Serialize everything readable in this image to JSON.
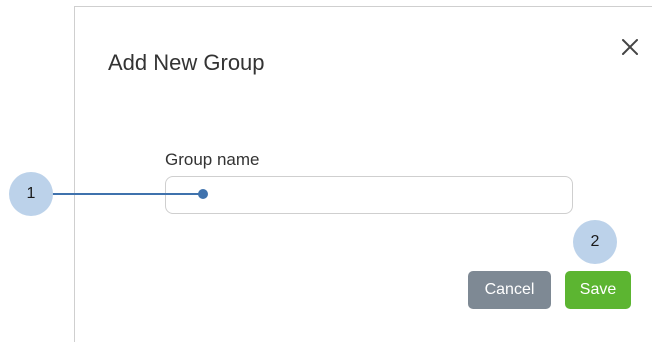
{
  "dialog": {
    "title": "Add New Group",
    "close_icon": "close-icon",
    "field": {
      "label": "Group name",
      "value": "",
      "placeholder": ""
    },
    "buttons": {
      "cancel_label": "Cancel",
      "save_label": "Save"
    }
  },
  "callouts": [
    {
      "number": "1"
    },
    {
      "number": "2"
    }
  ],
  "colors": {
    "callout_badge": "#bcd2ea",
    "callout_line": "#3f72ad",
    "cancel_button": "#7e8994",
    "save_button": "#5cb531",
    "border": "#cfcfcf"
  }
}
